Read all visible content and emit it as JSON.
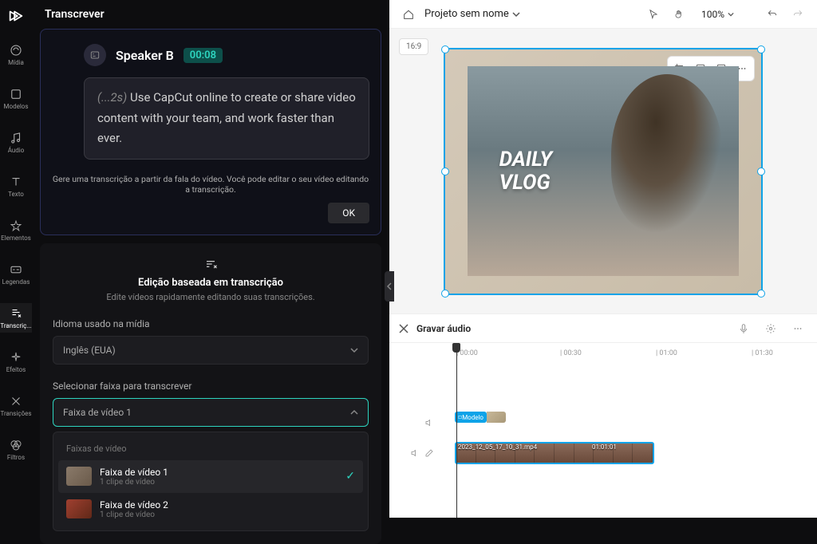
{
  "sidebar": {
    "items": [
      {
        "label": "Mídia"
      },
      {
        "label": "Modelos"
      },
      {
        "label": "Áudio"
      },
      {
        "label": "Texto"
      },
      {
        "label": "Elementos"
      },
      {
        "label": "Legendas"
      },
      {
        "label": "Transcriç..."
      },
      {
        "label": "Efeitos"
      },
      {
        "label": "Transições"
      },
      {
        "label": "Filtros"
      }
    ]
  },
  "panel": {
    "title": "Transcrever",
    "speaker_name": "Speaker B",
    "speaker_time": "00:08",
    "transcript_delay": "(...2s)",
    "transcript_text": "Use CapCut online to create or share video content with your team, and work faster than ever.",
    "promo_desc": "Gere uma transcrição a partir da fala do vídeo. Você pode editar o seu vídeo editando a transcrição.",
    "ok_label": "OK",
    "edit_title": "Edição baseada em transcrição",
    "edit_subtitle": "Edite vídeos rapidamente editando suas transcrições.",
    "lang_label": "Idioma usado na mídia",
    "lang_value": "Inglês (EUA)",
    "track_label": "Selecionar faixa para transcrever",
    "track_value": "Faixa de vídeo 1",
    "dropdown_header": "Faixas de vídeo",
    "tracks": [
      {
        "title": "Faixa de vídeo 1",
        "sub": "1 clipe de vídeo"
      },
      {
        "title": "Faixa de vídeo 2",
        "sub": "1 clipe de vídeo"
      }
    ]
  },
  "top": {
    "project_name": "Projeto sem nome",
    "zoom": "100%"
  },
  "canvas": {
    "ratio": "16:9",
    "overlay_line1": "DAILY",
    "overlay_line2": "VLOG"
  },
  "audio": {
    "label": "Gravar áudio"
  },
  "timeline": {
    "marks": [
      "| 00:00",
      "| 00:30",
      "| 01:00",
      "| 01:30"
    ],
    "model_label": "Modelo",
    "clip_name": "2023_12_05_17_10_31.mp4",
    "clip_duration": "01:01:01"
  }
}
